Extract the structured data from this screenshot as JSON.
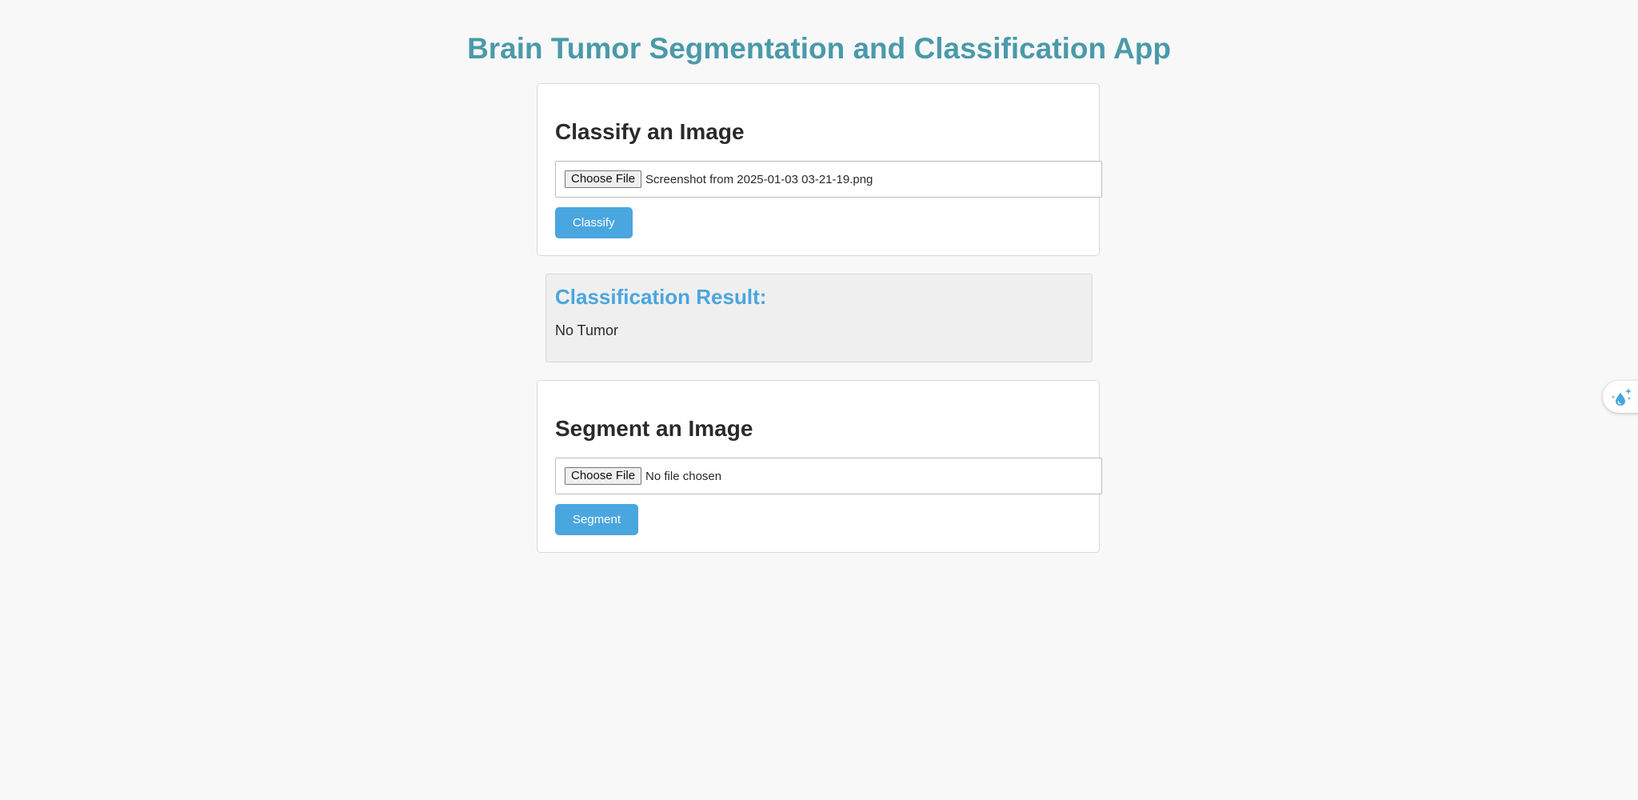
{
  "page": {
    "title": "Brain Tumor Segmentation and Classification App"
  },
  "classify": {
    "heading": "Classify an Image",
    "choose_file_label": "Choose File",
    "file_name": "Screenshot from 2025-01-03 03-21-19.png",
    "button_label": "Classify"
  },
  "result": {
    "heading": "Classification Result:",
    "value": "No Tumor"
  },
  "segment": {
    "heading": "Segment an Image",
    "choose_file_label": "Choose File",
    "file_name": "No file chosen",
    "button_label": "Segment"
  },
  "side_widget": {
    "icon": "droplet-sparkle-icon"
  },
  "colors": {
    "title": "#4a9aaa",
    "accent": "#4aa6de",
    "background": "#f8f8f8"
  }
}
